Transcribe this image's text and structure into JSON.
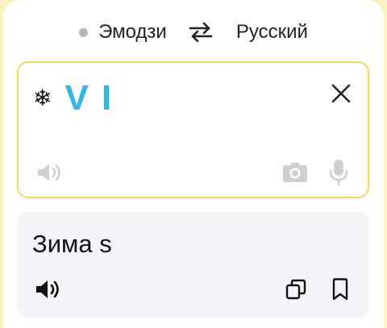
{
  "languages": {
    "source": "Эмодзи",
    "target": "Русский"
  },
  "input": {
    "prefix_emoji": "❄",
    "text": "V I"
  },
  "output": {
    "text": "Зима s"
  },
  "icons": {
    "swap": "swap-arrows-icon",
    "clear": "close-icon",
    "speaker": "speaker-icon",
    "camera": "camera-icon",
    "mic": "microphone-icon",
    "copy": "copy-icon",
    "bookmark": "bookmark-icon"
  },
  "colors": {
    "accent_border": "#f7d65a",
    "input_text": "#33b5e5",
    "disabled_icon": "#cfcfcf",
    "output_bg": "#f4f5f9"
  }
}
